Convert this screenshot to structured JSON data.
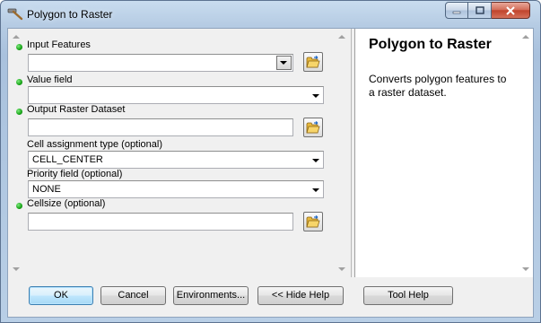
{
  "window": {
    "title": "Polygon to Raster"
  },
  "params": [
    {
      "label": "Input Features",
      "required": true,
      "type": "combo-browse",
      "value": ""
    },
    {
      "label": "Value field",
      "required": true,
      "type": "dropdown",
      "value": ""
    },
    {
      "label": "Output Raster Dataset",
      "required": true,
      "type": "text-browse",
      "value": ""
    },
    {
      "label": "Cell assignment type (optional)",
      "required": false,
      "type": "dropdown",
      "value": "CELL_CENTER"
    },
    {
      "label": "Priority field (optional)",
      "required": false,
      "type": "dropdown",
      "value": "NONE"
    },
    {
      "label": "Cellsize (optional)",
      "required": true,
      "type": "text-browse",
      "value": ""
    }
  ],
  "help": {
    "title": "Polygon to Raster",
    "description": "Converts polygon features to a raster dataset."
  },
  "buttons": {
    "ok": "OK",
    "cancel": "Cancel",
    "environments": "Environments...",
    "hide_help": "<< Hide Help",
    "tool_help": "Tool Help"
  }
}
